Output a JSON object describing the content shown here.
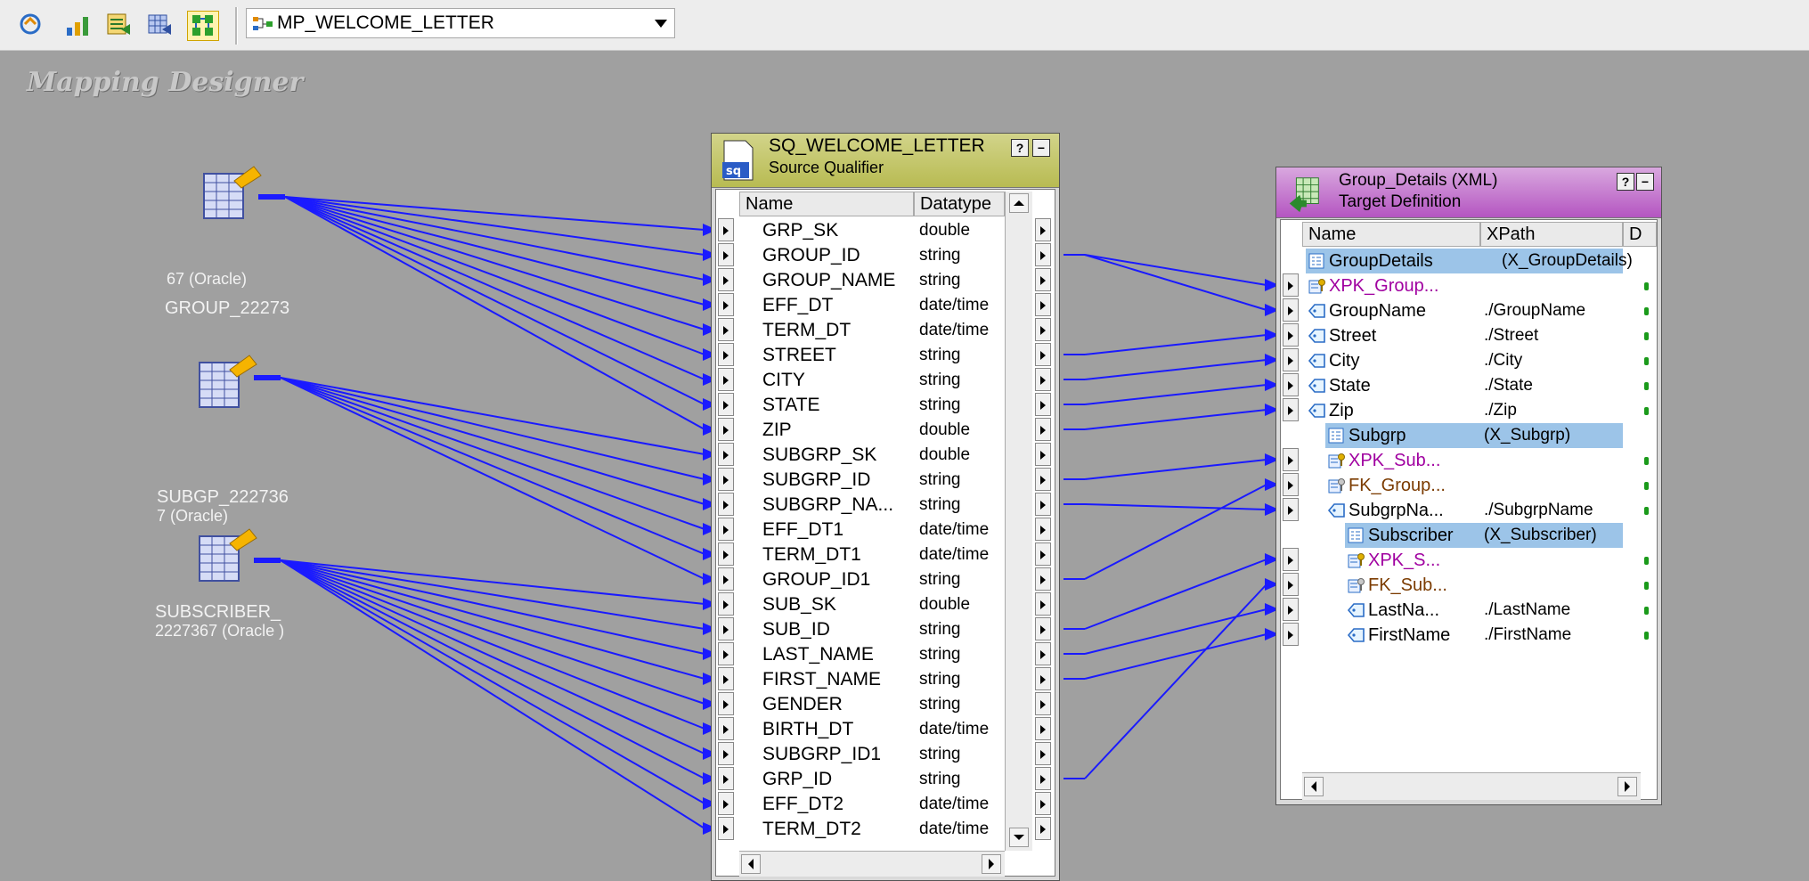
{
  "toolbar": {
    "buttons": [
      "map-icon",
      "chart-icon",
      "table-edit-icon",
      "table-icon",
      "mapping-overview-icon"
    ],
    "mapping_name": "MP_WELCOME_LETTER"
  },
  "canvas": {
    "title": "Mapping Designer"
  },
  "sources": [
    {
      "label_line1": "GROUP_22273",
      "label_line2": "67 (Oracle)"
    },
    {
      "label_line1": "SUBGP_222736",
      "label_line2": "7 (Oracle)"
    },
    {
      "label_line1": "SUBSCRIBER_",
      "label_line2": "2227367 (Oracle )"
    }
  ],
  "source_qualifier": {
    "title": "SQ_WELCOME_LETTER",
    "subtitle": "Source Qualifier",
    "help_label": "?",
    "minimize_label": "−",
    "columns": [
      "Name",
      "Datatype"
    ],
    "rows": [
      {
        "name": "GRP_SK",
        "type": "double"
      },
      {
        "name": "GROUP_ID",
        "type": "string"
      },
      {
        "name": "GROUP_NAME",
        "type": "string"
      },
      {
        "name": "EFF_DT",
        "type": "date/time"
      },
      {
        "name": "TERM_DT",
        "type": "date/time"
      },
      {
        "name": "STREET",
        "type": "string"
      },
      {
        "name": "CITY",
        "type": "string"
      },
      {
        "name": "STATE",
        "type": "string"
      },
      {
        "name": "ZIP",
        "type": "double"
      },
      {
        "name": "SUBGRP_SK",
        "type": "double"
      },
      {
        "name": "SUBGRP_ID",
        "type": "string"
      },
      {
        "name": "SUBGRP_NA...",
        "type": "string"
      },
      {
        "name": "EFF_DT1",
        "type": "date/time"
      },
      {
        "name": "TERM_DT1",
        "type": "date/time"
      },
      {
        "name": "GROUP_ID1",
        "type": "string"
      },
      {
        "name": "SUB_SK",
        "type": "double"
      },
      {
        "name": "SUB_ID",
        "type": "string"
      },
      {
        "name": "LAST_NAME",
        "type": "string"
      },
      {
        "name": "FIRST_NAME",
        "type": "string"
      },
      {
        "name": "GENDER",
        "type": "string"
      },
      {
        "name": "BIRTH_DT",
        "type": "date/time"
      },
      {
        "name": "SUBGRP_ID1",
        "type": "string"
      },
      {
        "name": "GRP_ID",
        "type": "string"
      },
      {
        "name": "EFF_DT2",
        "type": "date/time"
      },
      {
        "name": "TERM_DT2",
        "type": "date/time"
      }
    ]
  },
  "target": {
    "title": "Group_Details (XML)",
    "subtitle": "Target Definition",
    "help_label": "?",
    "minimize_label": "−",
    "columns": [
      "Name",
      "XPath",
      "D"
    ],
    "rows": [
      {
        "name": "GroupDetails",
        "xpath": "(X_GroupDetails)",
        "kind": "group",
        "indent": 0
      },
      {
        "name": "XPK_Group...",
        "xpath": "",
        "kind": "pk",
        "indent": 0
      },
      {
        "name": "GroupName",
        "xpath": "./GroupName",
        "kind": "attr",
        "indent": 0
      },
      {
        "name": "Street",
        "xpath": "./Street",
        "kind": "attr",
        "indent": 0
      },
      {
        "name": "City",
        "xpath": "./City",
        "kind": "attr",
        "indent": 0
      },
      {
        "name": "State",
        "xpath": "./State",
        "kind": "attr",
        "indent": 0
      },
      {
        "name": "Zip",
        "xpath": "./Zip",
        "kind": "attr",
        "indent": 0
      },
      {
        "name": "Subgrp",
        "xpath": "(X_Subgrp)",
        "kind": "group",
        "indent": 1
      },
      {
        "name": "XPK_Sub...",
        "xpath": "",
        "kind": "pk",
        "indent": 1
      },
      {
        "name": "FK_Group...",
        "xpath": "",
        "kind": "fk",
        "indent": 1
      },
      {
        "name": "SubgrpNa...",
        "xpath": "./SubgrpName",
        "kind": "attr",
        "indent": 1
      },
      {
        "name": "Subscriber",
        "xpath": "(X_Subscriber)",
        "kind": "group",
        "indent": 2
      },
      {
        "name": "XPK_S...",
        "xpath": "",
        "kind": "pk",
        "indent": 2
      },
      {
        "name": "FK_Sub...",
        "xpath": "",
        "kind": "fk",
        "indent": 2
      },
      {
        "name": "LastNa...",
        "xpath": "./LastName",
        "kind": "attr",
        "indent": 2
      },
      {
        "name": "FirstName",
        "xpath": "./FirstName",
        "kind": "attr",
        "indent": 2
      }
    ]
  },
  "colors": {
    "canvas_bg": "#a0a0a0",
    "link_color": "#1a1aff",
    "sq_header": "#c3c66a",
    "target_header": "#c070cc",
    "highlight": "#9cc4e8"
  }
}
